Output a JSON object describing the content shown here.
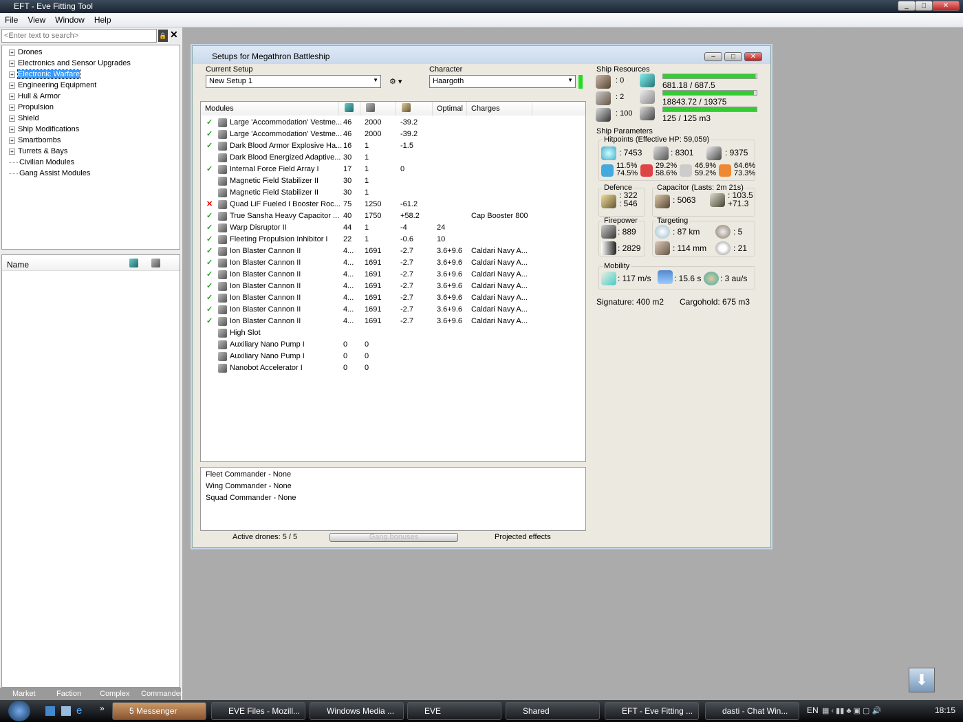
{
  "app": {
    "title": "EFT - Eve Fitting Tool",
    "menu": [
      "File",
      "View",
      "Window",
      "Help"
    ]
  },
  "left": {
    "search_placeholder": "<Enter text to search>",
    "tree": [
      {
        "label": "Drones",
        "exp": true
      },
      {
        "label": "Electronics and Sensor Upgrades",
        "exp": true
      },
      {
        "label": "Electronic Warfare",
        "exp": true,
        "selected": true
      },
      {
        "label": "Engineering Equipment",
        "exp": true
      },
      {
        "label": "Hull & Armor",
        "exp": true
      },
      {
        "label": "Propulsion",
        "exp": true
      },
      {
        "label": "Shield",
        "exp": true
      },
      {
        "label": "Ship Modifications",
        "exp": true
      },
      {
        "label": "Smartbombs",
        "exp": true
      },
      {
        "label": "Turrets & Bays",
        "exp": true
      },
      {
        "label": "Civilian Modules",
        "exp": false
      },
      {
        "label": "Gang Assist Modules",
        "exp": false
      }
    ],
    "list_header": "Name",
    "tabs": [
      "Market",
      "Faction",
      "Complex",
      "Commander"
    ]
  },
  "setup": {
    "title": "Setups for Megathron Battleship",
    "current_setup_label": "Current Setup",
    "current_setup": "New Setup 1",
    "character_label": "Character",
    "character": "Haargoth",
    "columns": [
      "Modules",
      "",
      "",
      "",
      "Optimal",
      "Charges"
    ],
    "modules": [
      {
        "s": "ok",
        "name": "Large 'Accommodation' Vestme...",
        "c1": "46",
        "c2": "2000",
        "c3": "-39.2",
        "opt": "",
        "ch": ""
      },
      {
        "s": "ok",
        "name": "Large 'Accommodation' Vestme...",
        "c1": "46",
        "c2": "2000",
        "c3": "-39.2",
        "opt": "",
        "ch": ""
      },
      {
        "s": "ok",
        "name": "Dark Blood Armor Explosive Ha...",
        "c1": "16",
        "c2": "1",
        "c3": "-1.5",
        "opt": "",
        "ch": ""
      },
      {
        "s": "",
        "name": "Dark Blood Energized Adaptive...",
        "c1": "30",
        "c2": "1",
        "c3": "",
        "opt": "",
        "ch": ""
      },
      {
        "s": "ok",
        "name": "Internal Force Field Array I",
        "c1": "17",
        "c2": "1",
        "c3": "0",
        "opt": "",
        "ch": ""
      },
      {
        "s": "",
        "name": "Magnetic Field Stabilizer II",
        "c1": "30",
        "c2": "1",
        "c3": "",
        "opt": "",
        "ch": ""
      },
      {
        "s": "",
        "name": "Magnetic Field Stabilizer II",
        "c1": "30",
        "c2": "1",
        "c3": "",
        "opt": "",
        "ch": ""
      },
      {
        "s": "bad",
        "name": "Quad LiF Fueled I Booster Roc...",
        "c1": "75",
        "c2": "1250",
        "c3": "-61.2",
        "opt": "",
        "ch": ""
      },
      {
        "s": "ok",
        "name": "True Sansha Heavy Capacitor ...",
        "c1": "40",
        "c2": "1750",
        "c3": "+58.2",
        "opt": "",
        "ch": "Cap Booster 800"
      },
      {
        "s": "ok",
        "name": "Warp Disruptor II",
        "c1": "44",
        "c2": "1",
        "c3": "-4",
        "opt": "24",
        "ch": ""
      },
      {
        "s": "ok",
        "name": "Fleeting Propulsion Inhibitor I",
        "c1": "22",
        "c2": "1",
        "c3": "-0.6",
        "opt": "10",
        "ch": ""
      },
      {
        "s": "ok",
        "name": "Ion Blaster Cannon II",
        "c1": "4...",
        "c2": "1691",
        "c3": "-2.7",
        "opt": "3.6+9.6",
        "ch": "Caldari Navy A..."
      },
      {
        "s": "ok",
        "name": "Ion Blaster Cannon II",
        "c1": "4...",
        "c2": "1691",
        "c3": "-2.7",
        "opt": "3.6+9.6",
        "ch": "Caldari Navy A..."
      },
      {
        "s": "ok",
        "name": "Ion Blaster Cannon II",
        "c1": "4...",
        "c2": "1691",
        "c3": "-2.7",
        "opt": "3.6+9.6",
        "ch": "Caldari Navy A..."
      },
      {
        "s": "ok",
        "name": "Ion Blaster Cannon II",
        "c1": "4...",
        "c2": "1691",
        "c3": "-2.7",
        "opt": "3.6+9.6",
        "ch": "Caldari Navy A..."
      },
      {
        "s": "ok",
        "name": "Ion Blaster Cannon II",
        "c1": "4...",
        "c2": "1691",
        "c3": "-2.7",
        "opt": "3.6+9.6",
        "ch": "Caldari Navy A..."
      },
      {
        "s": "ok",
        "name": "Ion Blaster Cannon II",
        "c1": "4...",
        "c2": "1691",
        "c3": "-2.7",
        "opt": "3.6+9.6",
        "ch": "Caldari Navy A..."
      },
      {
        "s": "ok",
        "name": "Ion Blaster Cannon II",
        "c1": "4...",
        "c2": "1691",
        "c3": "-2.7",
        "opt": "3.6+9.6",
        "ch": "Caldari Navy A..."
      },
      {
        "s": "",
        "name": "High Slot",
        "c1": "",
        "c2": "",
        "c3": "",
        "opt": "",
        "ch": ""
      },
      {
        "s": "",
        "name": "Auxiliary Nano Pump I",
        "c1": "0",
        "c2": "0",
        "c3": "",
        "opt": "",
        "ch": ""
      },
      {
        "s": "",
        "name": "Auxiliary Nano Pump I",
        "c1": "0",
        "c2": "0",
        "c3": "",
        "opt": "",
        "ch": ""
      },
      {
        "s": "",
        "name": "Nanobot Accelerator I",
        "c1": "0",
        "c2": "0",
        "c3": "",
        "opt": "",
        "ch": ""
      }
    ],
    "gang": [
      "Fleet Commander - None",
      "Wing Commander - None",
      "Squad Commander - None"
    ],
    "active_drones": "Active drones: 5 / 5",
    "gang_bonuses": "Gang bonuses",
    "projected": "Projected effects"
  },
  "stats": {
    "resources_label": "Ship Resources",
    "turrets": ": 0",
    "launchers": ": 2",
    "drone_bw": ": 100",
    "cpu": "681.18 / 687.5",
    "cpu_frac": 0.99,
    "pg": "18843.72 / 19375",
    "pg_frac": 0.97,
    "drone_bay": "125 / 125 m3",
    "drone_frac": 1.0,
    "params_label": "Ship Parameters",
    "hp_label": "Hitpoints (Effective HP: 59,059)",
    "shield": ": 7453",
    "armor": ": 8301",
    "structure": ": 9375",
    "res": [
      [
        "11.5%",
        "74.5%"
      ],
      [
        "29.2%",
        "58.6%"
      ],
      [
        "46.9%",
        "59.2%"
      ],
      [
        "64.6%",
        "73.3%"
      ]
    ],
    "defence_label": "Defence",
    "def1": ": 322",
    "def2": ": 546",
    "cap_label": "Capacitor (Lasts: 2m 21s)",
    "cap": ": 5063",
    "cap_use": ": 103.5",
    "cap_regen": "+71.3",
    "fire_label": "Firepower",
    "fire1": ": 889",
    "fire2": ": 2829",
    "target_label": "Targeting",
    "range": ": 87 km",
    "scan": ": 114 mm",
    "targets": ": 5",
    "sensor": ": 21",
    "mob_label": "Mobility",
    "speed": ": 117 m/s",
    "align": ": 15.6 s",
    "warp": ": 3 au/s",
    "signature": "Signature: 400 m2",
    "cargo": "Cargohold: 675 m3"
  },
  "taskbar": {
    "items": [
      "5 Messenger",
      "EVE Files - Mozill...",
      "Windows Media ...",
      "EVE",
      "Shared",
      "EFT - Eve Fitting ...",
      "dasti - Chat Win..."
    ],
    "lang": "EN",
    "clock": "18:15"
  }
}
